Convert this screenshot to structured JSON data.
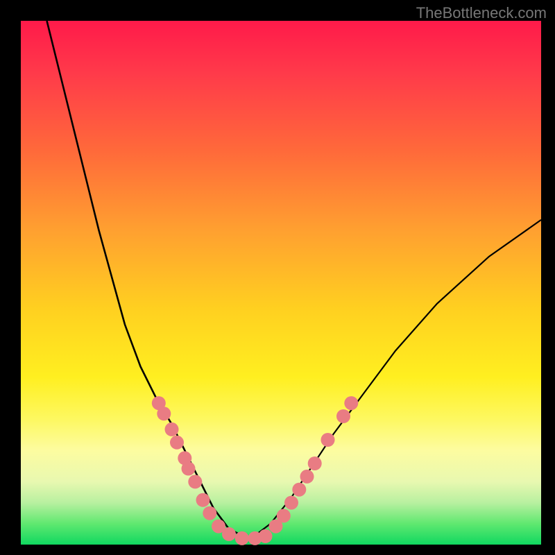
{
  "watermark": "TheBottleneck.com",
  "chart_data": {
    "type": "line",
    "title": "",
    "xlabel": "",
    "ylabel": "",
    "xlim": [
      0,
      100
    ],
    "ylim": [
      0,
      100
    ],
    "note": "Bottleneck profile chart: y-axis = bottleneck severity (0 green at bottom, 100 red at top). Background is a vertical severity gradient. Two curves descend into a shared minimum near x≈42, forming a V. Pink dot clusters highlight points on the curves in the lower band.",
    "series": [
      {
        "name": "left-curve",
        "x": [
          5,
          10,
          15,
          20,
          23,
          26,
          29,
          31,
          33,
          35,
          37,
          40,
          44
        ],
        "y": [
          100,
          80,
          60,
          42,
          34,
          28,
          23,
          19,
          15,
          11,
          7,
          3,
          1
        ]
      },
      {
        "name": "right-curve",
        "x": [
          44,
          48,
          52,
          56,
          60,
          66,
          72,
          80,
          90,
          100
        ],
        "y": [
          1,
          4,
          9,
          15,
          21,
          29,
          37,
          46,
          55,
          62
        ]
      }
    ],
    "highlight_dots_left": [
      {
        "x": 26.5,
        "y": 27
      },
      {
        "x": 27.5,
        "y": 25
      },
      {
        "x": 29,
        "y": 22
      },
      {
        "x": 30,
        "y": 19.5
      },
      {
        "x": 31.5,
        "y": 16.5
      },
      {
        "x": 32.2,
        "y": 14.5
      },
      {
        "x": 33.5,
        "y": 12
      },
      {
        "x": 35,
        "y": 8.5
      },
      {
        "x": 36.3,
        "y": 6
      },
      {
        "x": 38,
        "y": 3.5
      },
      {
        "x": 40,
        "y": 2
      },
      {
        "x": 42.5,
        "y": 1.2
      },
      {
        "x": 45,
        "y": 1.2
      },
      {
        "x": 47,
        "y": 1.6
      }
    ],
    "highlight_dots_right": [
      {
        "x": 49,
        "y": 3.5
      },
      {
        "x": 50.5,
        "y": 5.5
      },
      {
        "x": 52,
        "y": 8
      },
      {
        "x": 53.5,
        "y": 10.5
      },
      {
        "x": 55,
        "y": 13
      },
      {
        "x": 56.5,
        "y": 15.5
      },
      {
        "x": 59,
        "y": 20
      },
      {
        "x": 62,
        "y": 24.5
      },
      {
        "x": 63.5,
        "y": 27
      }
    ],
    "colors": {
      "curve": "#000000",
      "dot_fill": "#e97c83",
      "dot_stroke": "#d96a72",
      "gradient_top": "#ff1a4a",
      "gradient_bottom": "#10d860"
    }
  }
}
